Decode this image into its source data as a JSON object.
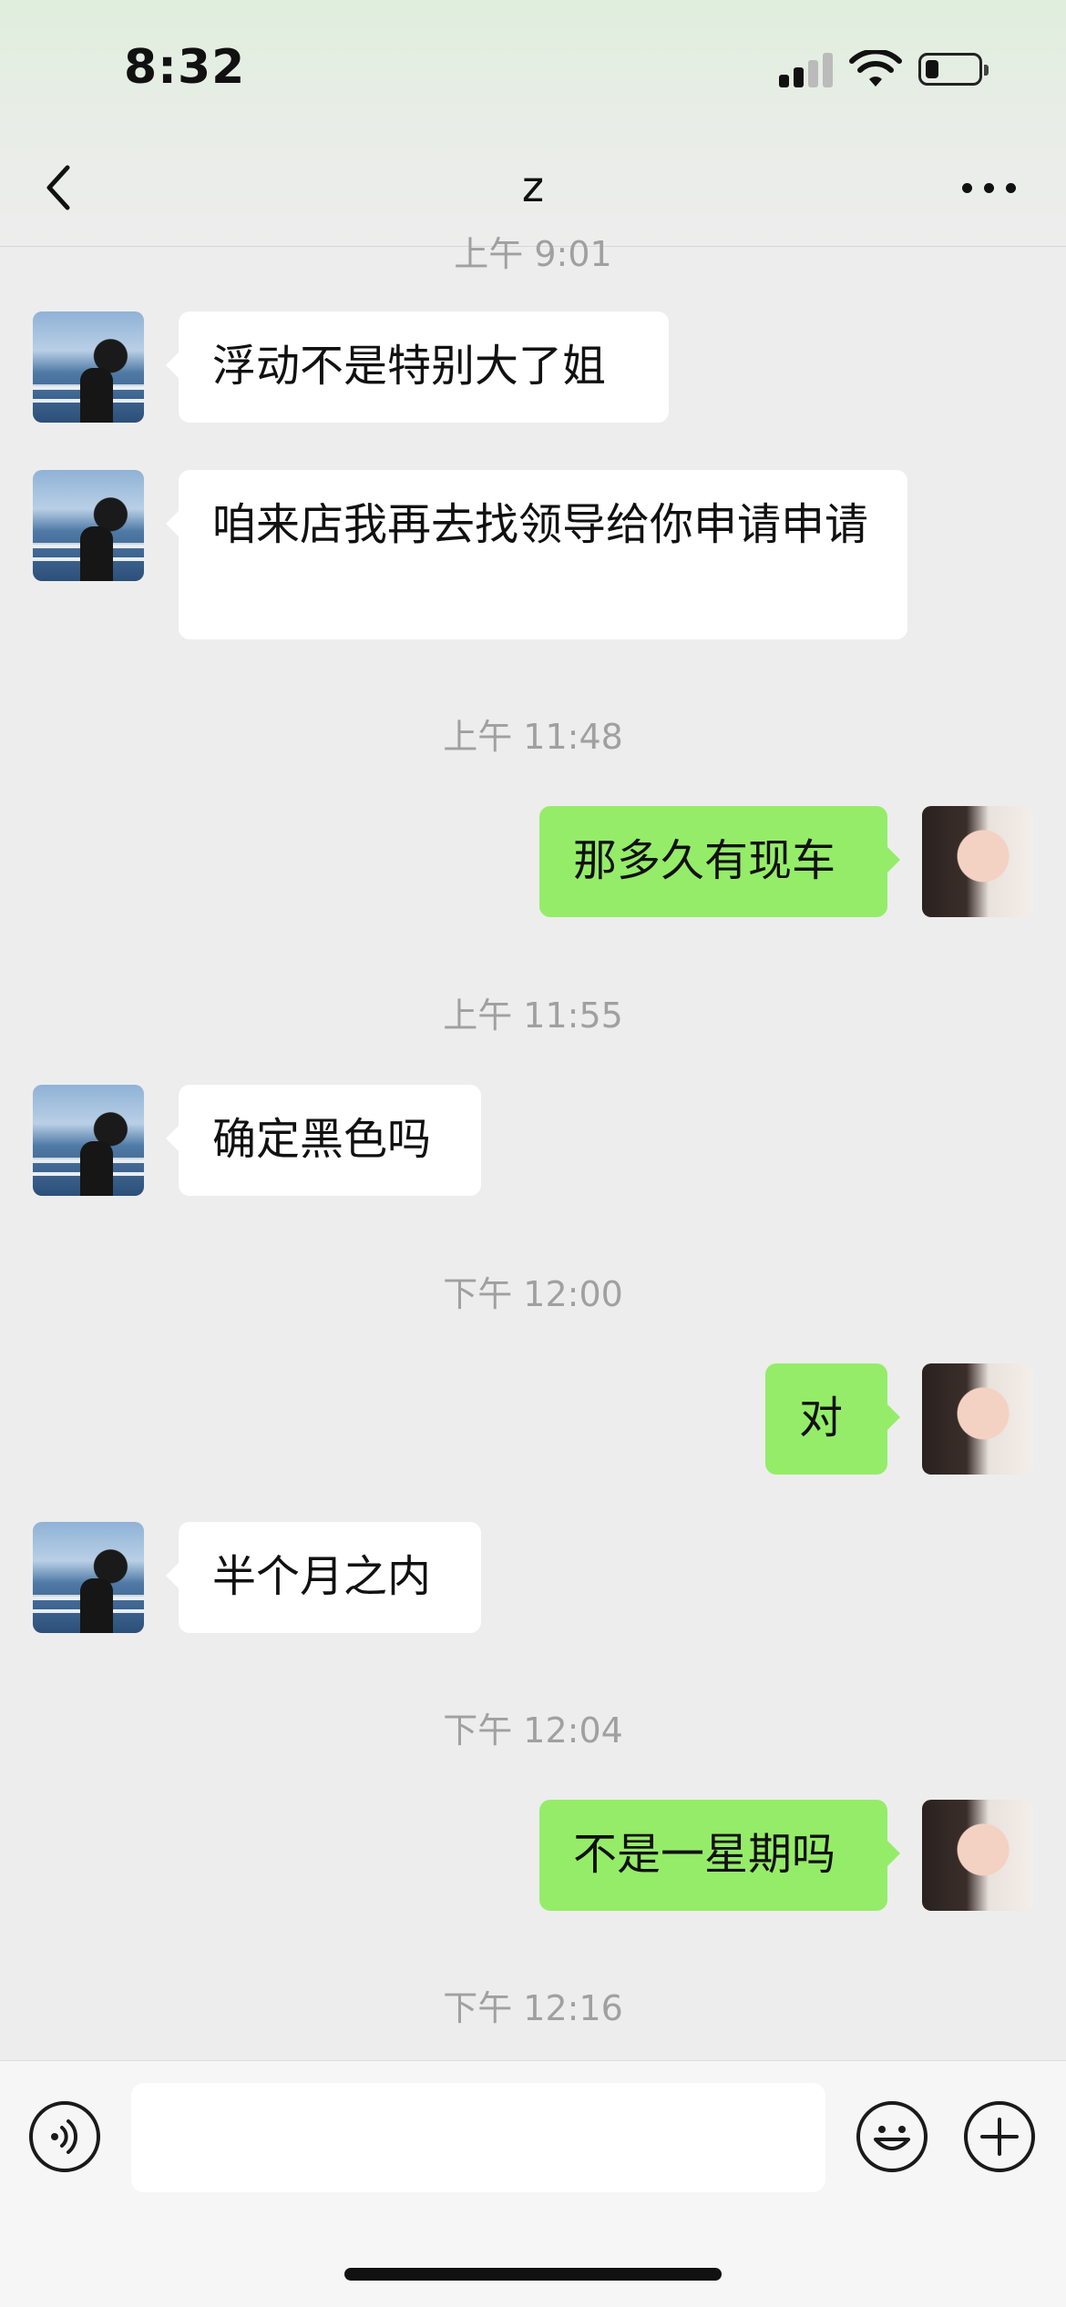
{
  "status_bar": {
    "time": "8:32"
  },
  "header": {
    "title": "z"
  },
  "timestamps": {
    "cut_top": "上午 9:01",
    "t1": "上午 11:48",
    "t2": "上午 11:55",
    "t3": "下午 12:00",
    "t4": "下午 12:04",
    "t5": "下午 12:16"
  },
  "messages": [
    {
      "side": "left",
      "text": "浮动不是特别大了姐"
    },
    {
      "side": "left",
      "text": "咱来店我再去找领导给你申请申请"
    },
    {
      "side": "right",
      "text": "那多久有现车"
    },
    {
      "side": "left",
      "text": "确定黑色吗"
    },
    {
      "side": "right",
      "text": "对"
    },
    {
      "side": "left",
      "text": "半个月之内"
    },
    {
      "side": "right",
      "text": "不是一星期吗"
    }
  ],
  "input": {
    "value": "",
    "placeholder": ""
  },
  "icons": [
    "back-chevron-icon",
    "more-dots-icon",
    "voice-icon",
    "emoji-icon",
    "plus-icon"
  ],
  "colors": {
    "my_bubble": "#95ec69",
    "their_bubble": "#ffffff",
    "background": "#ededed"
  }
}
